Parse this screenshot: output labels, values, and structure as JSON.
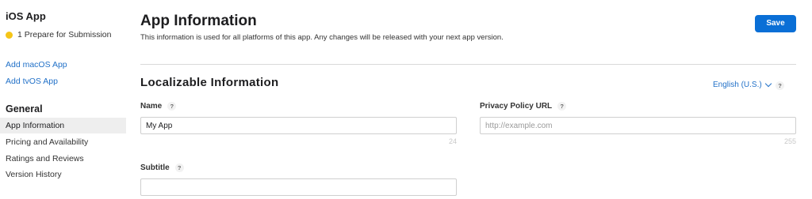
{
  "sidebar": {
    "app_title": "iOS App",
    "status": {
      "text": "1 Prepare for Submission",
      "dot_color": "#f5c518"
    },
    "links": [
      {
        "label": "Add macOS App"
      },
      {
        "label": "Add tvOS App"
      }
    ],
    "section_title": "General",
    "items": [
      {
        "label": "App Information",
        "active": true
      },
      {
        "label": "Pricing and Availability",
        "active": false
      },
      {
        "label": "Ratings and Reviews",
        "active": false
      },
      {
        "label": "Version History",
        "active": false
      }
    ]
  },
  "header": {
    "title": "App Information",
    "subtitle": "This information is used for all platforms of this app. Any changes will be released with your next app version.",
    "save_label": "Save",
    "accent_color": "#0a6fd6"
  },
  "localizable": {
    "section_title": "Localizable Information",
    "language": "English (U.S.)",
    "help_glyph": "?",
    "fields": {
      "name": {
        "label": "Name",
        "value": "My App",
        "placeholder": "",
        "counter": "24"
      },
      "privacy_url": {
        "label": "Privacy Policy URL",
        "value": "",
        "placeholder": "http://example.com",
        "counter": "255"
      },
      "subtitle": {
        "label": "Subtitle",
        "value": "",
        "placeholder": ""
      }
    }
  },
  "icons": {
    "status": "status-dot-icon",
    "help": "help-icon",
    "dropdown": "chevron-down-icon"
  }
}
